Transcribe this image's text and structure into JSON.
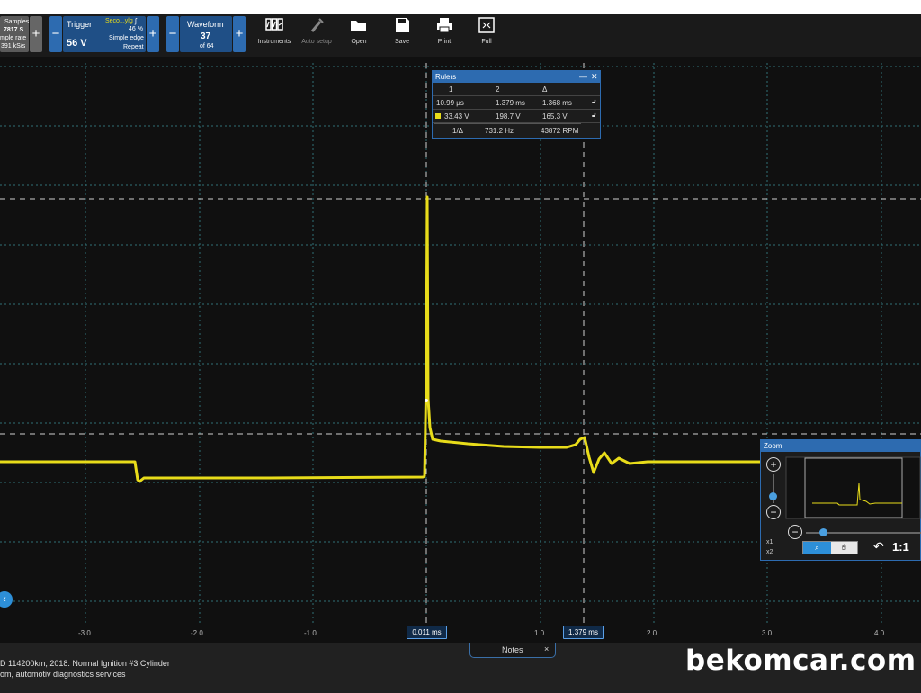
{
  "toolbar": {
    "samples": {
      "label": "Samples",
      "value": "7817 S",
      "rate_label": "mple rate",
      "rate_value": "391 kS/s"
    },
    "trigger": {
      "title": "Trigger",
      "level": "56 V",
      "channel": "Seco...ylg",
      "percent": "46 %",
      "mode": "Simple edge",
      "repeat": "Repeat"
    },
    "waveform": {
      "title": "Waveform",
      "current": "37",
      "total": "of 64"
    },
    "minus": "−",
    "plus": "+",
    "tools": [
      {
        "label": "Instruments",
        "icon": "instruments-icon"
      },
      {
        "label": "Auto setup",
        "icon": "auto-setup-icon",
        "disabled": true
      },
      {
        "label": "Open",
        "icon": "folder-open-icon"
      },
      {
        "label": "Save",
        "icon": "save-icon"
      },
      {
        "label": "Print",
        "icon": "print-icon"
      },
      {
        "label": "Full",
        "icon": "fullscreen-icon"
      }
    ]
  },
  "rulers": {
    "title": "Rulers",
    "minimize": "—",
    "close": "✕",
    "headers": [
      "1",
      "2",
      "Δ"
    ],
    "time_row": [
      "10.99 µs",
      "1.379 ms",
      "1.368 ms"
    ],
    "volt_row": [
      "33.43 V",
      "198.7 V",
      "165.3 V"
    ],
    "freq_row": {
      "label": "1/Δ",
      "hz": "731.2 Hz",
      "rpm": "43872 RPM"
    }
  },
  "plot": {
    "trace_color": "#e8dc1a",
    "grid_color": "#2f6f76",
    "x_ticks": [
      "-3.0",
      "-2.0",
      "-1.0",
      "1.0",
      "2.0",
      "3.0",
      "4.0"
    ],
    "cursor_labels": [
      "0.011 ms",
      "1.379 ms"
    ]
  },
  "zoom": {
    "title": "Zoom",
    "plus": "+",
    "minus": "−",
    "x1": "x1",
    "x2": "x2",
    "ratio": "1:1"
  },
  "bottom": {
    "notes_label": "Notes",
    "notes_close": "×",
    "line1": "D 114200km, 2018. Normal Ignition #3 Cylinder",
    "line2": "om, automotiv diagnostics services",
    "watermark": "bekomcar.com"
  }
}
